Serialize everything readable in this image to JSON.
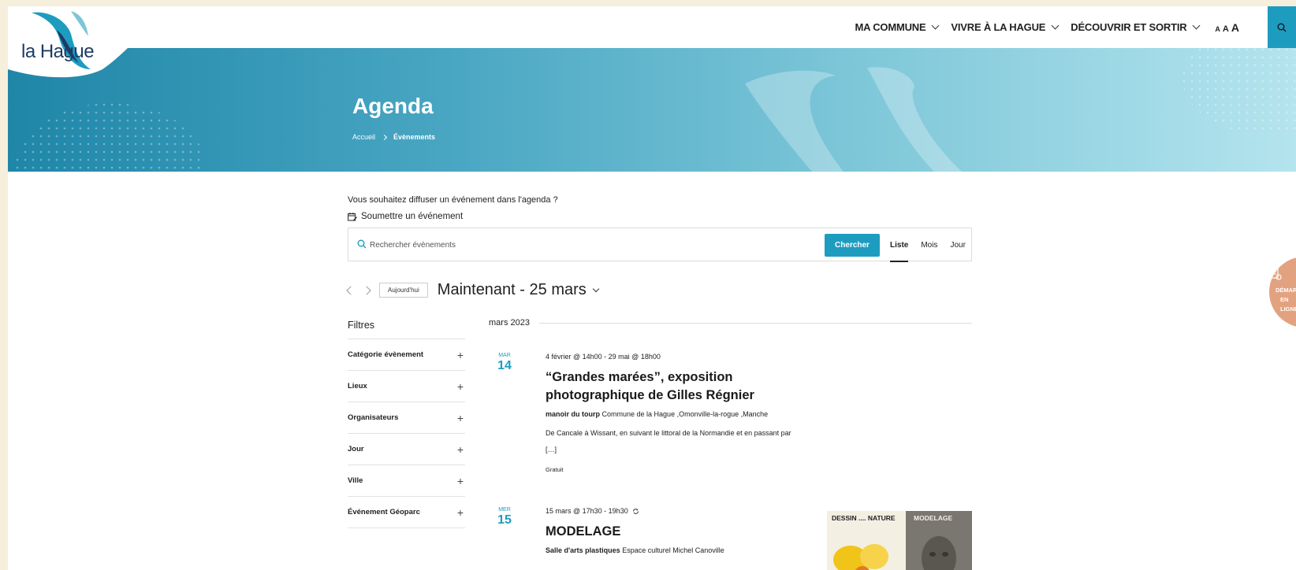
{
  "logo": {
    "text": "la Hague"
  },
  "nav": {
    "items": [
      {
        "label": "MA COMMUNE"
      },
      {
        "label": "VIVRE À LA HAGUE"
      },
      {
        "label": "DÉCOUVRIR ET SORTIR"
      }
    ],
    "text_size": [
      "A",
      "A",
      "A"
    ]
  },
  "hero": {
    "title": "Agenda",
    "breadcrumb": {
      "home": "Accueil",
      "current": "Évènements"
    }
  },
  "submit": {
    "question": "Vous souhaitez diffuser un événement dans l'agenda ?",
    "link": "Soumettre un événement"
  },
  "search": {
    "placeholder": "Rechercher évènements",
    "button": "Chercher",
    "views": [
      "Liste",
      "Mois",
      "Jour"
    ],
    "active_view": "Liste"
  },
  "date_nav": {
    "today_button": "Aujourd'hui",
    "range": "Maintenant - 25 mars"
  },
  "filters": {
    "title": "Filtres",
    "items": [
      {
        "label": "Catégorie évènement"
      },
      {
        "label": "Lieux"
      },
      {
        "label": "Organisateurs"
      },
      {
        "label": "Jour"
      },
      {
        "label": "Ville"
      },
      {
        "label": "Événement Géoparc"
      }
    ],
    "toggle_symbol": "+"
  },
  "month_separator": "mars 2023",
  "events": [
    {
      "dow": "MAR",
      "day": "14",
      "when": "4 février @ 14h00 - 29 mai @ 18h00",
      "title": "“Grandes marées”, exposition photographique de Gilles Régnier",
      "venue_name": "manoir du tourp",
      "venue_address": "Commune de la Hague ,Omonville-la-rogue ,Manche",
      "description": "De Cancale à Wissant, en suivant le littoral de la Normandie et en passant par […]",
      "cost": "Gratuit"
    },
    {
      "dow": "MER",
      "day": "15",
      "when": "15 mars @ 17h30 - 19h30",
      "title": "MODELAGE",
      "venue_name": "Salle d'arts plastiques",
      "venue_address": "Espace culturel Michel Canoville",
      "image_labels": [
        "DESSIN .... NATURE",
        "MODELAGE"
      ]
    }
  ],
  "side_badge": {
    "line1": "DÉMARCH",
    "line2": "EN LIGNE"
  },
  "colors": {
    "accent": "#1e9cc0",
    "badge": "#e3a27f",
    "backdrop": "#f5efdc"
  }
}
